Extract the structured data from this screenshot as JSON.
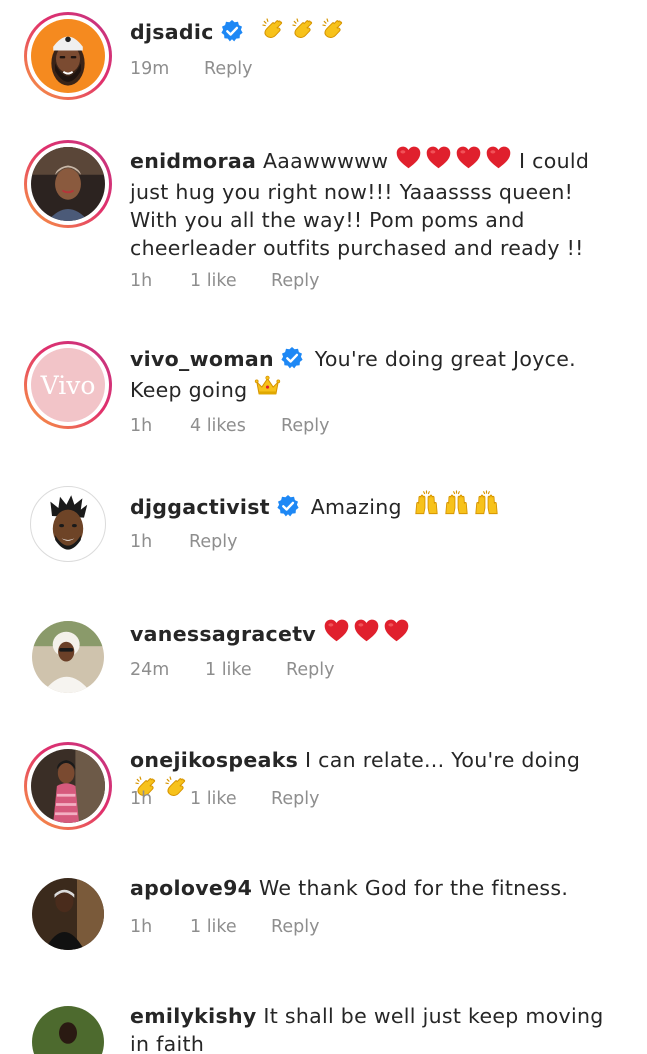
{
  "comments": [
    {
      "username": "djsadic",
      "verified": true,
      "text": "",
      "emoji": "clapping-hands-x3",
      "time": "19m",
      "likes": "",
      "reply": "Reply"
    },
    {
      "username": "enidmoraa",
      "verified": false,
      "text_before": "Aaawwwww",
      "text": "I could just hug you right now!!! Yaaassss queen! With you all the way!! Pom poms and cheerleader outfits purchased and ready !!",
      "emoji": "red-heart-x4",
      "time": "1h",
      "likes": "1 like",
      "reply": "Reply"
    },
    {
      "username": "vivo_woman",
      "verified": true,
      "text": "You're doing great Joyce. Keep going",
      "emoji": "crown",
      "avatar_text": "Vivo",
      "time": "1h",
      "likes": "4 likes",
      "reply": "Reply"
    },
    {
      "username": "djggactivist",
      "verified": true,
      "text": "Amazing",
      "emoji": "raising-hands-x3",
      "time": "1h",
      "likes": "",
      "reply": "Reply"
    },
    {
      "username": "vanessagracetv",
      "verified": false,
      "text": "",
      "emoji": "red-heart-x3",
      "time": "24m",
      "likes": "1 like",
      "reply": "Reply"
    },
    {
      "username": "onejikospeaks",
      "verified": false,
      "text": "I can relate... You're doing",
      "emoji": "clapping-hands-x2",
      "time": "1h",
      "likes": "1 like",
      "reply": "Reply"
    },
    {
      "username": "apolove94",
      "verified": false,
      "text": "We thank God for the fitness.",
      "emoji": "",
      "time": "1h",
      "likes": "1 like",
      "reply": "Reply"
    },
    {
      "username": "emilykishy",
      "verified": false,
      "text": "It shall be well just keep moving in faith",
      "emoji": "",
      "time": "",
      "likes": "",
      "reply": ""
    }
  ],
  "colors": {
    "text": "#262626",
    "meta": "#8e8e8e",
    "verified": "#1e88f5",
    "heart": "#e0202d",
    "emoji": "#f5b800"
  }
}
